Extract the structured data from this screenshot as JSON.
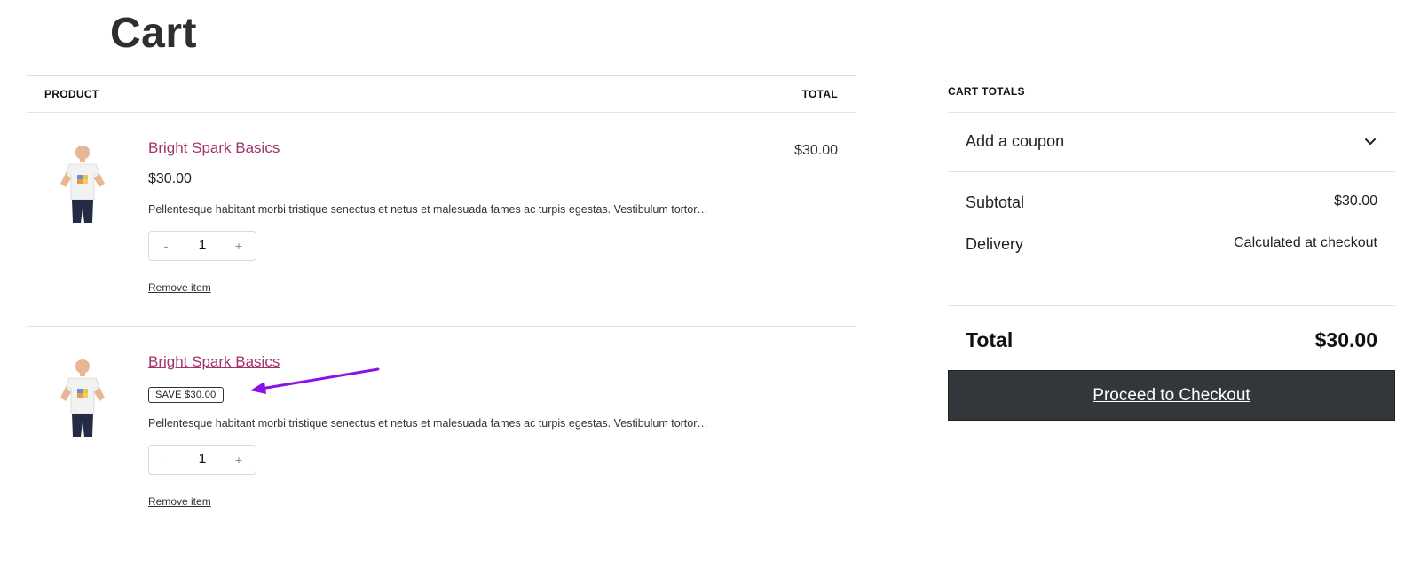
{
  "page": {
    "title": "Cart"
  },
  "cart_table": {
    "headers": {
      "product": "PRODUCT",
      "total": "TOTAL"
    },
    "items": [
      {
        "name": "Bright Spark Basics",
        "price": "$30.00",
        "description": "Pellentesque habitant morbi tristique senectus et netus et malesuada fames ac turpis egestas. Vestibulum tortor…",
        "quantity": "1",
        "decrement": "-",
        "increment": "+",
        "remove": "Remove item",
        "total": "$30.00"
      },
      {
        "name": "Bright Spark Basics",
        "badge": "SAVE $30.00",
        "description": "Pellentesque habitant morbi tristique senectus et netus et malesuada fames ac turpis egestas. Vestibulum tortor…",
        "quantity": "1",
        "decrement": "-",
        "increment": "+",
        "remove": "Remove item",
        "total": ""
      }
    ]
  },
  "totals": {
    "title": "CART TOTALS",
    "coupon_label": "Add a coupon",
    "coupon_icon": "chevron-down-icon",
    "subtotal_label": "Subtotal",
    "subtotal_value": "$30.00",
    "delivery_label": "Delivery",
    "delivery_value": "Calculated at checkout",
    "total_label": "Total",
    "total_value": "$30.00",
    "checkout_label": "Proceed to Checkout"
  },
  "colors": {
    "link": "#a0346b",
    "checkout_bg": "#32373c",
    "annotation_arrow": "#8a12e6"
  }
}
